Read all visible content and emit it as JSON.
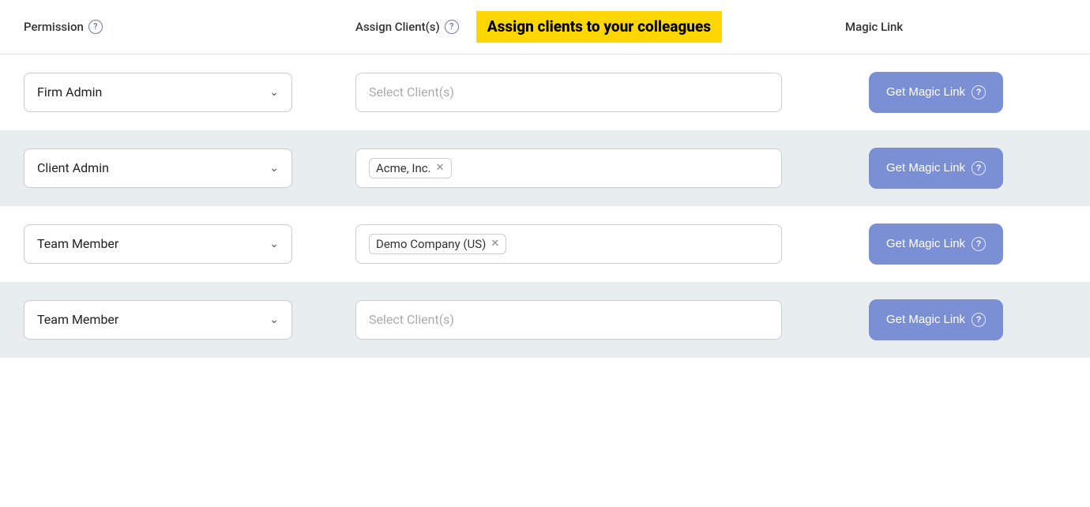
{
  "header": {
    "permission_label": "Permission",
    "assign_clients_label": "Assign Client(s)",
    "highlight_text": "Assign clients to your colleagues",
    "magic_link_label": "Magic Link",
    "help_icon_label": "?"
  },
  "rows": [
    {
      "id": "row1",
      "bg": "white",
      "permission_value": "Firm Admin",
      "client_placeholder": "Select Client(s)",
      "client_value": null,
      "magic_link_btn": "Get Magic Link"
    },
    {
      "id": "row2",
      "bg": "gray",
      "permission_value": "Client Admin",
      "client_placeholder": null,
      "client_value": "Acme, Inc.",
      "magic_link_btn": "Get Magic Link"
    },
    {
      "id": "row3",
      "bg": "white",
      "permission_value": "Team Member",
      "client_placeholder": null,
      "client_value": "Demo Company (US)",
      "magic_link_btn": "Get Magic Link"
    },
    {
      "id": "row4",
      "bg": "gray",
      "permission_value": "Team Member",
      "client_placeholder": "Select Client(s)",
      "client_value": null,
      "magic_link_btn": "Get Magic Link"
    }
  ],
  "colors": {
    "button_bg": "#7b8fd4",
    "highlight_bg": "#FFD700",
    "row_gray_bg": "#e8edf0",
    "row_white_bg": "#ffffff"
  }
}
